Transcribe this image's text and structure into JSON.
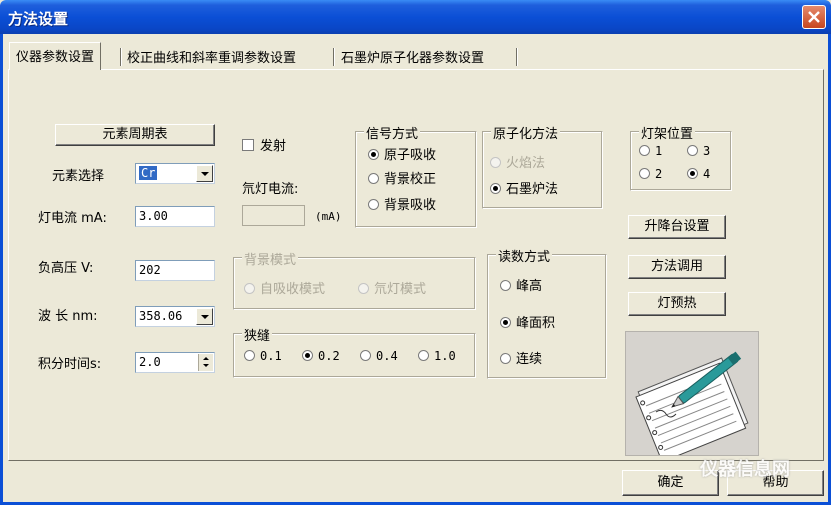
{
  "window": {
    "title": "方法设置",
    "close_icon": "close-icon"
  },
  "tabs": [
    {
      "label": "仪器参数设置",
      "active": true
    },
    {
      "label": "校正曲线和斜率重调参数设置",
      "active": false
    },
    {
      "label": "石墨炉原子化器参数设置",
      "active": false
    }
  ],
  "left": {
    "periodic_table_button": "元素周期表",
    "element_label": "元素选择",
    "element_value": "Cr",
    "lamp_current_label": "灯电流 mA:",
    "lamp_current_value": "3.00",
    "high_voltage_label": "负高压 V:",
    "high_voltage_value": "202",
    "wavelength_label": "波 长 nm:",
    "wavelength_value": "358.06",
    "integration_label": "积分时间s:",
    "integration_value": "2.0"
  },
  "middle": {
    "emission_label": "发射",
    "emission_checked": false,
    "deuterium_current_label": "氘灯电流:",
    "deuterium_current_value": "",
    "deuterium_unit": "(mA)",
    "background_mode": {
      "title": "背景模式",
      "options": [
        "自吸收模式",
        "氘灯模式"
      ],
      "enabled": false
    },
    "slit": {
      "title": "狭缝",
      "options": [
        "0.1",
        "0.2",
        "0.4",
        "1.0"
      ],
      "selected": "0.2"
    }
  },
  "signal_mode": {
    "title": "信号方式",
    "options": [
      "原子吸收",
      "背景校正",
      "背景吸收"
    ],
    "selected": "原子吸收"
  },
  "atomization": {
    "title": "原子化方法",
    "options": [
      "火焰法",
      "石墨炉法"
    ],
    "selected": "石墨炉法",
    "disabled": [
      "火焰法"
    ]
  },
  "reading_mode": {
    "title": "读数方式",
    "options": [
      "峰高",
      "峰面积",
      "连续"
    ],
    "selected": "峰面积"
  },
  "lamp_position": {
    "title": "灯架位置",
    "options": [
      "1",
      "3",
      "2",
      "4"
    ],
    "selected": "4"
  },
  "right_buttons": {
    "lift_setting": "升降台设置",
    "method_load": "方法调用",
    "lamp_preheat": "灯预热"
  },
  "illustration": "notepad-with-pen-icon",
  "footer": {
    "ok": "确定",
    "help": "帮助"
  },
  "watermark": "仪器信息网",
  "colors": {
    "titlebar": "#0b4fd6",
    "dialog_bg": "#ece9d8",
    "selection": "#316ac5",
    "close_button": "#c8461f"
  }
}
